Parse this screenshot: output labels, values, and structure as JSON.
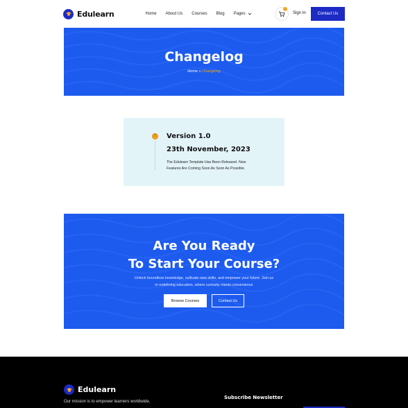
{
  "brand": {
    "name": "Edulearn",
    "color": "#1d2bc4",
    "icon": "graduation-cap-icon"
  },
  "nav": {
    "items": [
      "Home",
      "About Us",
      "Courses",
      "Blog",
      "Pages"
    ],
    "signin": "Sign In",
    "contact": "Contact Us"
  },
  "hero": {
    "title": "Changelog",
    "crumb_home": "Home",
    "crumb_sep": " » ",
    "crumb_current": "Changelog"
  },
  "changelog": {
    "dot_label": "1",
    "version": "Version 1.0",
    "date": "23th November, 2023",
    "desc_line1": "The Edulearn Template Has Been Released. New",
    "desc_line2": "Features Are Coming Soon As Soon As Possible."
  },
  "cta": {
    "title_line1": "Are You Ready",
    "title_line2": "To Start Your Course?",
    "text_line1": "Unlock boundless knowledge, cultivate new skills, and empower your future. Join us",
    "text_line2": "in redefining education, where curiosity meets convenience",
    "browse": "Browse Courses",
    "contact": "Contact Us"
  },
  "footer": {
    "mission": "Our mission is to empower learners worldwide,",
    "newsletter_title": "Subscribe Newsletter"
  },
  "colors": {
    "accent": "#1d5bef",
    "highlight": "#f5a623",
    "card_bg": "#e3f4f9"
  }
}
